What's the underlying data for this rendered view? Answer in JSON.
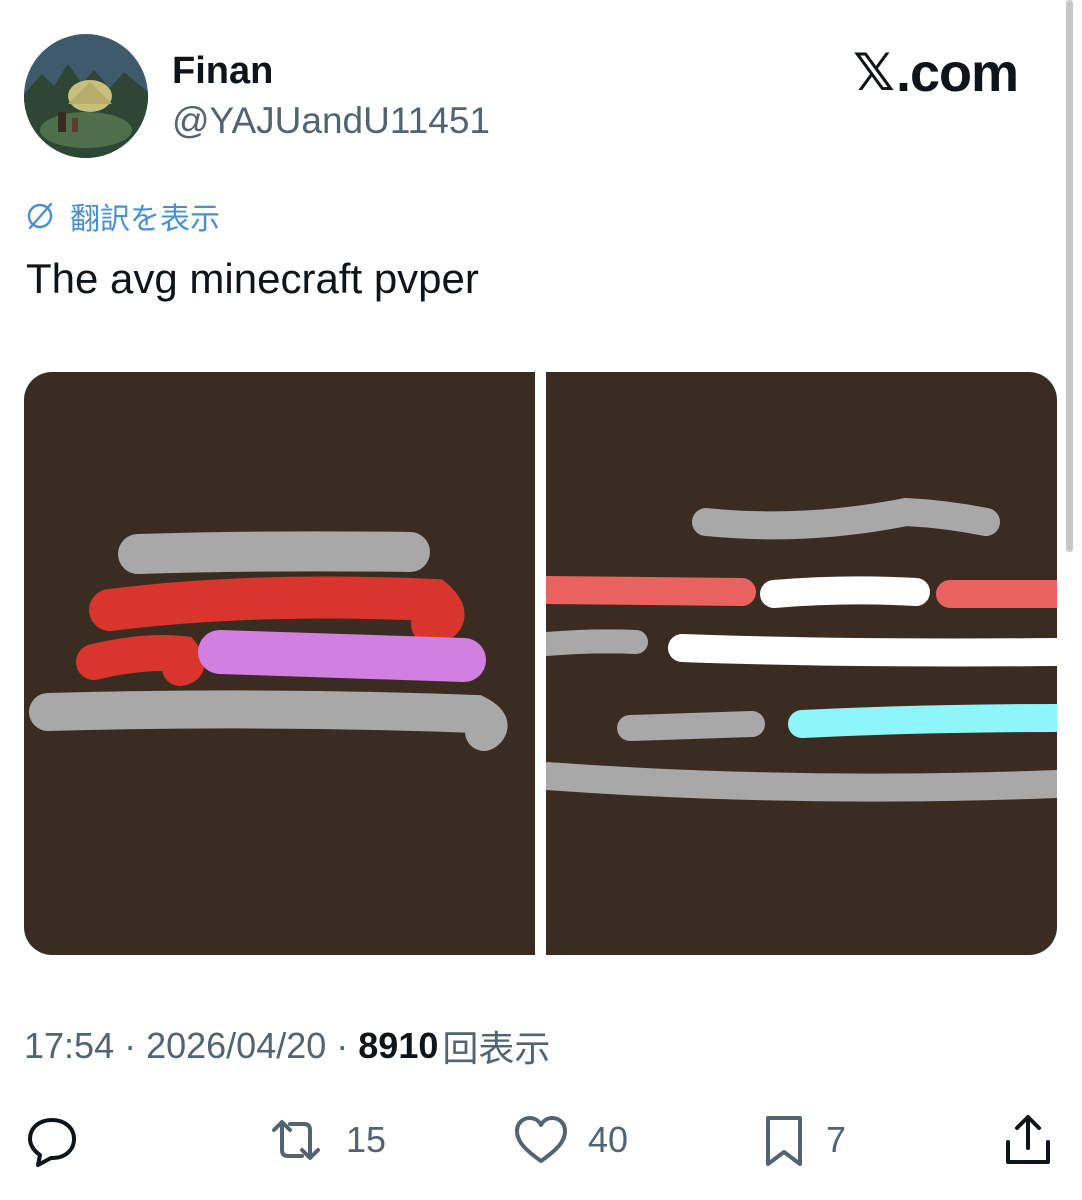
{
  "author": {
    "name": "Finan",
    "handle": "@YAJUandU11451"
  },
  "brand": {
    "mark": "𝕏",
    "domain": ".com"
  },
  "translate": {
    "label": "翻訳を表示"
  },
  "tweet": {
    "text": "The avg minecraft pvper"
  },
  "meta": {
    "time": "17:54",
    "separator": " · ",
    "date": "2026/04/20",
    "views_count": "8910",
    "views_label": "回表示"
  },
  "actions": {
    "reply": {
      "icon": "reply-icon",
      "count": ""
    },
    "retweet": {
      "icon": "retweet-icon",
      "count": "15"
    },
    "like": {
      "icon": "heart-icon",
      "count": "40"
    },
    "bookmark": {
      "icon": "bookmark-icon",
      "count": "7"
    },
    "share": {
      "icon": "share-icon",
      "count": ""
    }
  },
  "colors": {
    "panel_background": "#3b2c22",
    "gray_stroke": "#a8a8a8",
    "red_stroke": "#d8352d",
    "purple_stroke": "#d17fe0",
    "salmon_stroke": "#e8625f",
    "white_stroke": "#ffffff",
    "cyan_stroke": "#8ef6f8",
    "link_blue": "#4a8fd0",
    "secondary_text": "#536471"
  }
}
